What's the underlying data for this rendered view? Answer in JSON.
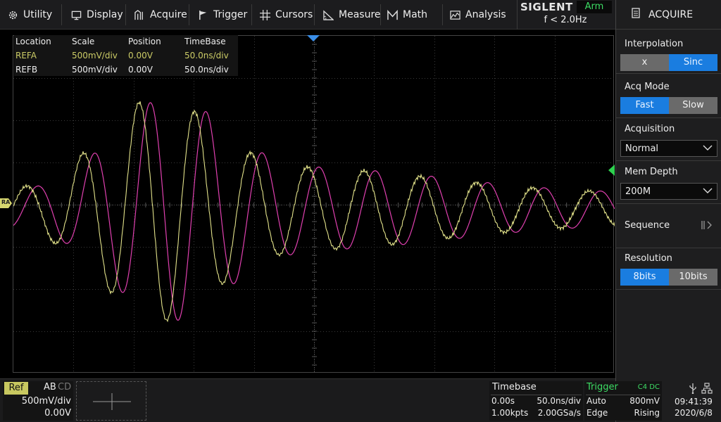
{
  "menu": [
    {
      "label": "Utility",
      "icon": "gear-icon"
    },
    {
      "label": "Display",
      "icon": "monitor-icon"
    },
    {
      "label": "Acquire",
      "icon": "acquire-icon"
    },
    {
      "label": "Trigger",
      "icon": "flag-icon"
    },
    {
      "label": "Cursors",
      "icon": "crosshair-icon"
    },
    {
      "label": "Measure",
      "icon": "ruler-icon"
    },
    {
      "label": "Math",
      "icon": "math-m-icon"
    },
    {
      "label": "Analysis",
      "icon": "analysis-icon"
    }
  ],
  "brand": {
    "logo": "SIGLENT",
    "status": "Arm",
    "freq": "f < 2.0Hz"
  },
  "panel": {
    "title": "ACQUIRE",
    "interpolation": {
      "label": "Interpolation",
      "options": [
        "x",
        "Sinc"
      ],
      "selected": "Sinc"
    },
    "acq_mode": {
      "label": "Acq Mode",
      "options": [
        "Fast",
        "Slow"
      ],
      "selected": "Fast"
    },
    "acquisition": {
      "label": "Acquisition",
      "value": "Normal"
    },
    "mem_depth": {
      "label": "Mem Depth",
      "value": "200M"
    },
    "sequence": {
      "label": "Sequence"
    },
    "resolution": {
      "label": "Resolution",
      "options": [
        "8bits",
        "10bits"
      ],
      "selected": "8bits"
    }
  },
  "ref_table": {
    "headers": [
      "Location",
      "Scale",
      "Position",
      "TimeBase"
    ],
    "rows": [
      [
        "REFA",
        "500mV/div",
        "0.00V",
        "50.0ns/div"
      ],
      [
        "REFB",
        "500mV/div",
        "0.00V",
        "50.0ns/div"
      ]
    ]
  },
  "screen": {
    "ref_marker": "RA"
  },
  "bottom": {
    "ref": {
      "tag": "Ref",
      "letters_active": "AB",
      "letters_inactive": "CD",
      "scale": "500mV/div",
      "offset": "0.00V"
    },
    "timebase": {
      "title": "Timebase",
      "delay": "0.00s",
      "scale": "50.0ns/div",
      "points": "1.00kpts",
      "rate": "2.00GSa/s"
    },
    "trigger": {
      "title": "Trigger",
      "source": "C4 DC",
      "mode": "Auto",
      "level": "800mV",
      "type": "Edge",
      "slope": "Rising"
    },
    "clock": {
      "time": "09:41:39",
      "date": "2020/6/8"
    }
  },
  "colors": {
    "refa": "#e2e28a",
    "refb": "#e040b0",
    "accent": "#1a7de0",
    "grid": "#3a3a3a",
    "trigger": "#3ddc64"
  }
}
